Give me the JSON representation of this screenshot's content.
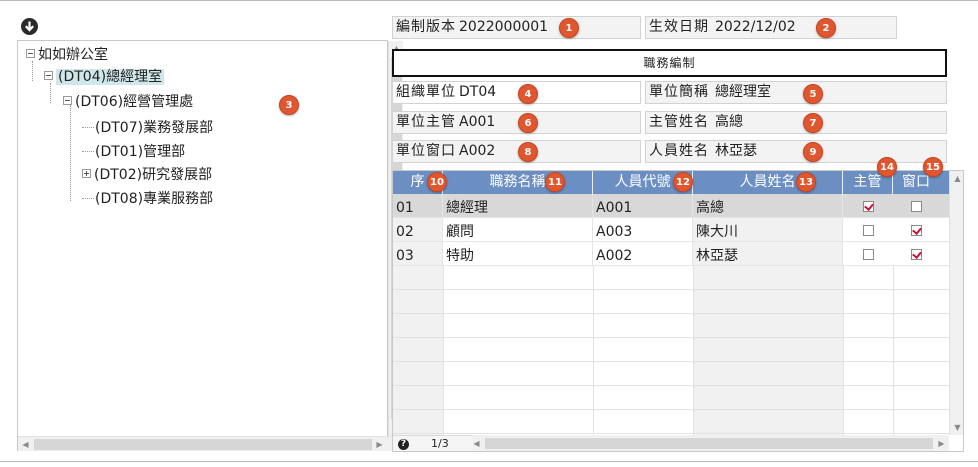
{
  "tree": {
    "root": "如如辦公室",
    "nodes": [
      {
        "label": "(DT04)總經理室"
      },
      {
        "label": "(DT06)經營管理處"
      },
      {
        "label": "(DT07)業務發展部"
      },
      {
        "label": "(DT01)管理部"
      },
      {
        "label": "(DT02)研究發展部"
      },
      {
        "label": "(DT08)專業服務部"
      }
    ]
  },
  "form": {
    "version_label": "編制版本",
    "version_value": "2022000001",
    "effective_label": "生效日期",
    "effective_value": "2022/12/02",
    "section_title": "職務編制",
    "org_unit_label": "組織單位",
    "org_unit_value": "DT04",
    "unit_short_label": "單位簡稱",
    "unit_short_value": "總經理室",
    "unit_head_label": "單位主管",
    "unit_head_value": "A001",
    "head_name_label": "主管姓名",
    "head_name_value": "高總",
    "unit_contact_label": "單位窗口",
    "unit_contact_value": "A002",
    "contact_name_label": "人員姓名",
    "contact_name_value": "林亞瑟"
  },
  "grid": {
    "headers": [
      "序",
      "職務名稱",
      "人員代號",
      "人員姓名",
      "主管",
      "窗口"
    ],
    "rows": [
      {
        "seq": "01",
        "title": "總經理",
        "code": "A001",
        "name": "高總",
        "manager": true,
        "contact": false
      },
      {
        "seq": "02",
        "title": "顧問",
        "code": "A003",
        "name": "陳大川",
        "manager": false,
        "contact": true
      },
      {
        "seq": "03",
        "title": "特助",
        "code": "A002",
        "name": "林亞瑟",
        "manager": false,
        "contact": true
      }
    ],
    "page_indicator": "1/3"
  },
  "badges": [
    "1",
    "2",
    "3",
    "4",
    "5",
    "6",
    "7",
    "8",
    "9",
    "10",
    "11",
    "12",
    "13",
    "14",
    "15"
  ],
  "colors": {
    "grid_header": "#6b8ec3",
    "badge": "#e0572f",
    "selected_tree_node": "#cfe6ea",
    "checkmark": "#c8102e"
  },
  "icons": {
    "download": "download-icon",
    "help": "help-icon"
  }
}
